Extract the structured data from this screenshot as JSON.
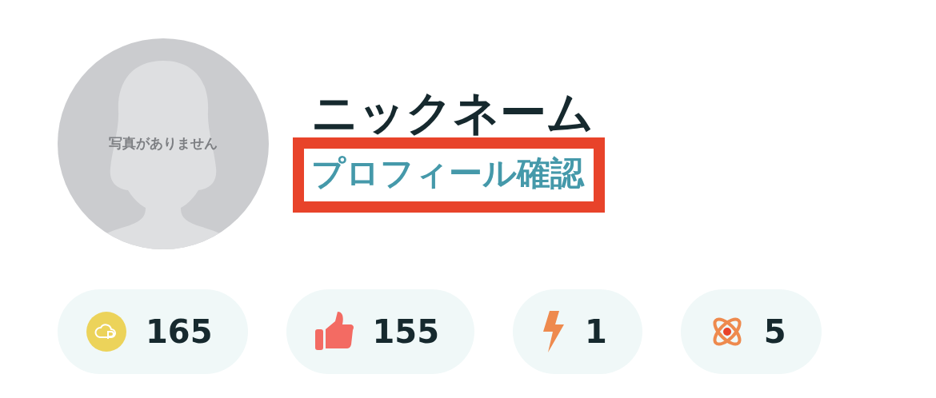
{
  "avatar": {
    "placeholder_text": "写真がありません"
  },
  "nickname": "ニックネーム",
  "profile_link": {
    "label": "プロフィール確認",
    "highlighted": true
  },
  "stats": [
    {
      "kind": "points",
      "value": "165"
    },
    {
      "kind": "likes",
      "value": "155"
    },
    {
      "kind": "energy",
      "value": "1"
    },
    {
      "kind": "atom",
      "value": "5"
    }
  ]
}
